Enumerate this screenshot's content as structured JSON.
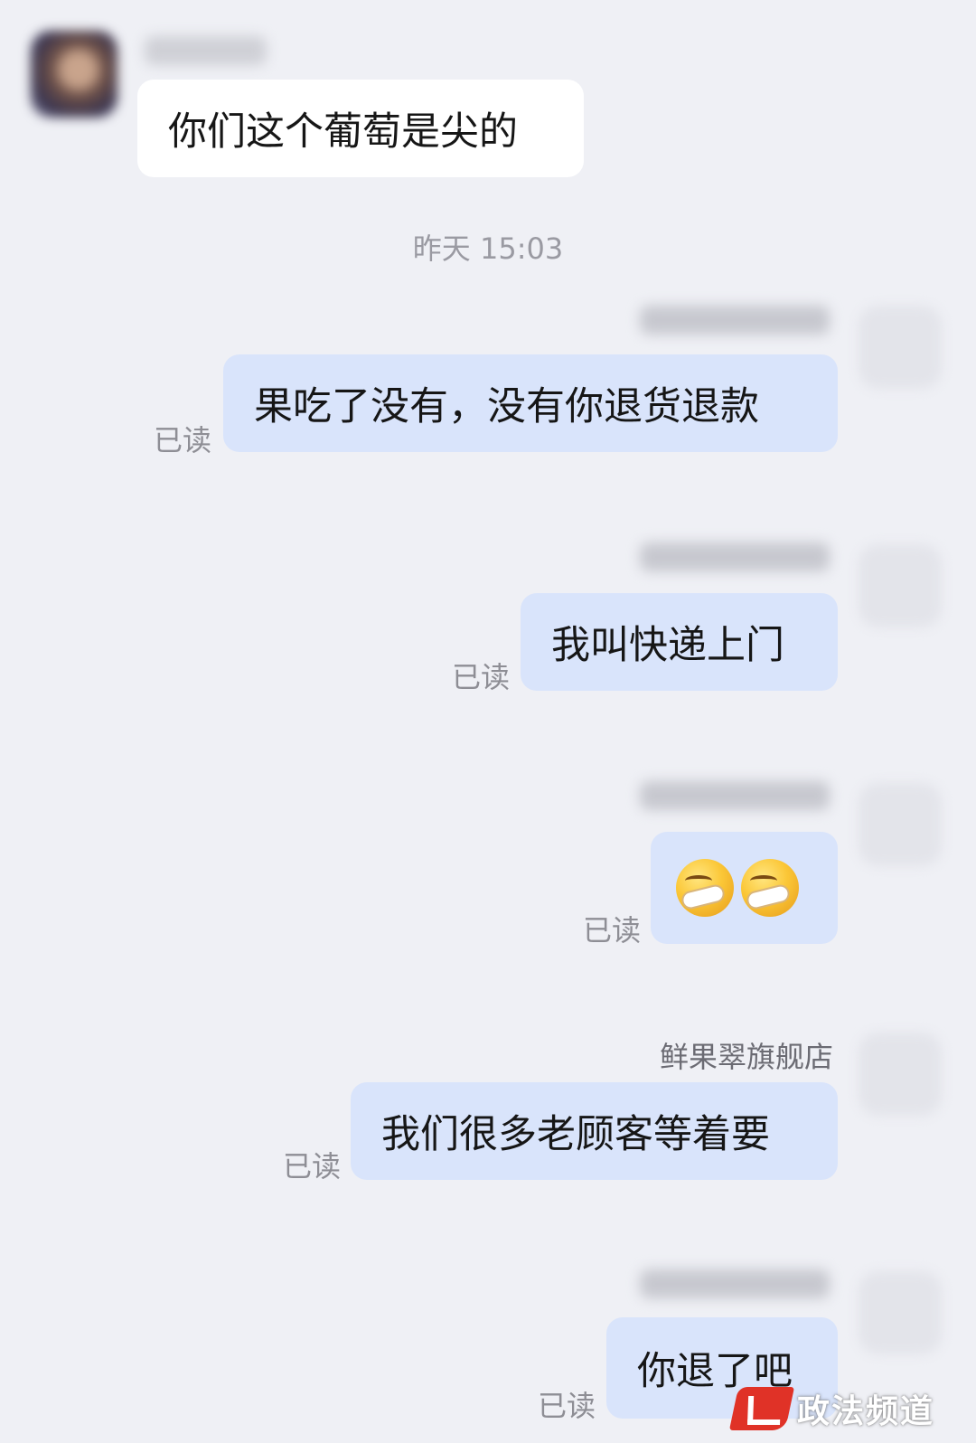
{
  "timestamp": "昨天 15:03",
  "messages": [
    {
      "text": "你们这个葡萄是尖的"
    },
    {
      "text": "果吃了没有，没有你退货退款",
      "status": "已读"
    },
    {
      "text": "我叫快递上门",
      "status": "已读"
    },
    {
      "emoji": [
        "face-with-hand-over-mouth-icon",
        "face-with-hand-over-mouth-icon"
      ],
      "status": "已读"
    },
    {
      "sender": "鲜果翠旗舰店",
      "text": "我们很多老顾客等着要",
      "status": "已读"
    },
    {
      "text": "你退了吧",
      "status": "已读"
    }
  ],
  "watermark": {
    "text": "政法频道"
  },
  "colors": {
    "background": "#eff0f5",
    "incoming_bubble": "#ffffff",
    "outgoing_bubble": "#d9e4fb",
    "watermark_logo": "#e03227"
  }
}
